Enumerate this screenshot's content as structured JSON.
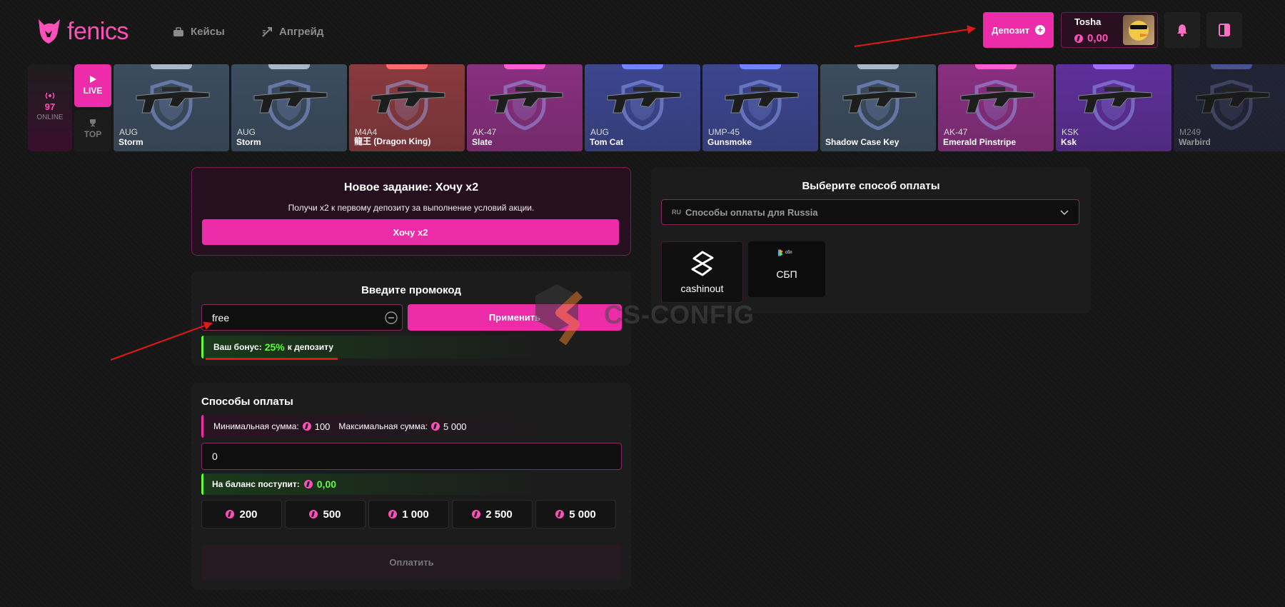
{
  "brand": {
    "name": "fenics"
  },
  "nav": [
    {
      "label": "Кейсы",
      "icon": "briefcase-icon"
    },
    {
      "label": "Апгрейд",
      "icon": "upgrade-icon"
    }
  ],
  "header": {
    "deposit_label": "Депозит",
    "user": {
      "name": "Tosha",
      "balance": "0,00"
    }
  },
  "live": {
    "online_count": "97",
    "online_label": "ONLINE",
    "live_label": "LIVE",
    "top_label": "TOP"
  },
  "drops": [
    {
      "weapon": "AUG",
      "skin": "Storm",
      "color": "#3c4d60",
      "tab": "#a9b8c8"
    },
    {
      "weapon": "AUG",
      "skin": "Storm",
      "color": "#3c4d60",
      "tab": "#a9b8c8"
    },
    {
      "weapon": "M4A4",
      "skin": "龍王 (Dragon King)",
      "color": "#8a3a3e",
      "tab": "#ff6b6b"
    },
    {
      "weapon": "AK-47",
      "skin": "Slate",
      "color": "#8a2f80",
      "tab": "#ff5cd9"
    },
    {
      "weapon": "AUG",
      "skin": "Tom Cat",
      "color": "#3c4690",
      "tab": "#6f84ff"
    },
    {
      "weapon": "UMP-45",
      "skin": "Gunsmoke",
      "color": "#3c4690",
      "tab": "#6f84ff"
    },
    {
      "weapon": "",
      "skin": "Shadow Case Key",
      "color": "#3c4d60",
      "tab": "#a9b8c8"
    },
    {
      "weapon": "AK-47",
      "skin": "Emerald Pinstripe",
      "color": "#8a2f80",
      "tab": "#ff5cd9"
    },
    {
      "weapon": "KSK",
      "skin": "Ksk",
      "color": "#5e2f9a",
      "tab": "#a46cff"
    },
    {
      "weapon": "M249",
      "skin": "Warbird",
      "color": "#2c3050",
      "tab": "#6f84ff"
    }
  ],
  "quest": {
    "title": "Новое задание: Хочу x2",
    "description": "Получи x2 к первому депозиту за выполнение условий акции.",
    "button": "Хочу x2"
  },
  "promo": {
    "title": "Введите промокод",
    "value": "free",
    "apply_label": "Применить",
    "bonus_prefix": "Ваш бонус:",
    "bonus_value": "25%",
    "bonus_suffix": "к депозиту"
  },
  "payment": {
    "title": "Способы оплаты",
    "min_label": "Минимальная сумма:",
    "min_value": "100",
    "max_label": "Максимальная сумма:",
    "max_value": "5 000",
    "amount_value": "0",
    "receive_label": "На баланс поступит:",
    "receive_value": "0,00",
    "presets": [
      "200",
      "500",
      "1 000",
      "2 500",
      "5 000"
    ],
    "pay_label": "Оплатить"
  },
  "method": {
    "title": "Выберите способ оплаты",
    "region_code": "RU",
    "region_label": "Способы оплаты для Russia",
    "options": [
      {
        "label": "cashinout"
      },
      {
        "label": "СБП"
      }
    ]
  },
  "watermark": {
    "text": "CS-CONFIG"
  },
  "colors": {
    "accent": "#ec2ca9",
    "bonus_green": "#5cff3a",
    "background": "#161616"
  }
}
